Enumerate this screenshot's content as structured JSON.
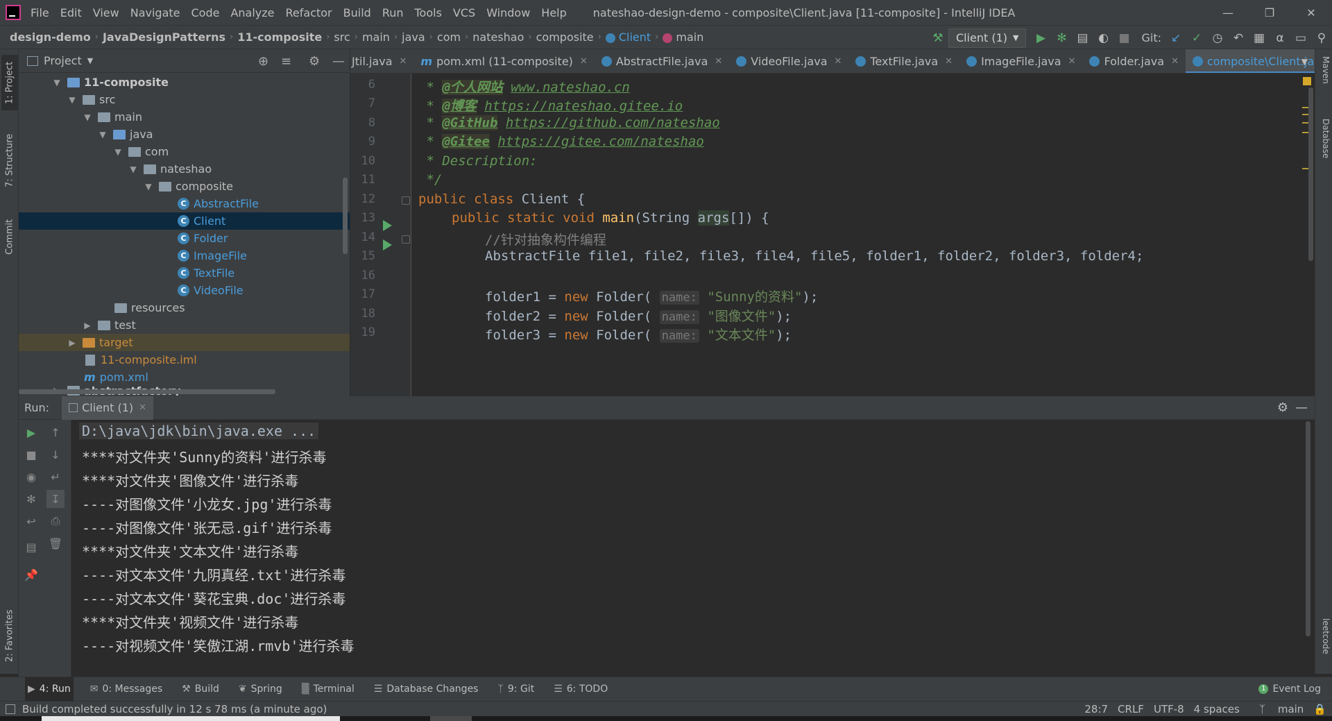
{
  "menubar": {
    "items": [
      "File",
      "Edit",
      "View",
      "Navigate",
      "Code",
      "Analyze",
      "Refactor",
      "Build",
      "Run",
      "Tools",
      "VCS",
      "Window",
      "Help"
    ],
    "window_title": "nateshao-design-demo - composite\\Client.java [11-composite] - IntelliJ IDEA"
  },
  "navbar": {
    "crumbs": [
      "design-demo",
      "JavaDesignPatterns",
      "11-composite",
      "src",
      "main",
      "java",
      "com",
      "nateshao",
      "composite"
    ],
    "class_name": "Client",
    "method_name": "main",
    "run_config": "Client (1)",
    "git_label": "Git:"
  },
  "project": {
    "title": "Project",
    "tree": [
      {
        "label": "11-composite",
        "kind": "module"
      },
      {
        "label": "src",
        "kind": "folder"
      },
      {
        "label": "main",
        "kind": "folder"
      },
      {
        "label": "java",
        "kind": "folder"
      },
      {
        "label": "com",
        "kind": "folder"
      },
      {
        "label": "nateshao",
        "kind": "folder"
      },
      {
        "label": "composite",
        "kind": "folder"
      },
      {
        "label": "AbstractFile",
        "kind": "class"
      },
      {
        "label": "Client",
        "kind": "class"
      },
      {
        "label": "Folder",
        "kind": "class"
      },
      {
        "label": "ImageFile",
        "kind": "class"
      },
      {
        "label": "TextFile",
        "kind": "class"
      },
      {
        "label": "VideoFile",
        "kind": "class"
      },
      {
        "label": "resources",
        "kind": "folder"
      },
      {
        "label": "test",
        "kind": "folder"
      },
      {
        "label": "target",
        "kind": "folder"
      },
      {
        "label": "11-composite.iml",
        "kind": "file"
      },
      {
        "label": "pom.xml",
        "kind": "file"
      },
      {
        "label": "abstractfactory",
        "kind": "module"
      }
    ]
  },
  "tabs": [
    {
      "label": "Jtil.java"
    },
    {
      "label": "pom.xml (11-composite)"
    },
    {
      "label": "AbstractFile.java"
    },
    {
      "label": "VideoFile.java"
    },
    {
      "label": "TextFile.java"
    },
    {
      "label": "ImageFile.java"
    },
    {
      "label": "Folder.java"
    },
    {
      "label": "composite\\Client.java"
    }
  ],
  "editor": {
    "line_numbers": [
      "6",
      "7",
      "8",
      "9",
      "10",
      "11",
      "12",
      "13",
      "14",
      "15",
      "16",
      "17",
      "18",
      "19"
    ],
    "line6": {
      "star": " * ",
      "tag": "@个人网站",
      "url": "www.nateshao.cn"
    },
    "line7": {
      "star": " * ",
      "tag": "@博客",
      "url": "https://nateshao.gitee.io"
    },
    "line8": {
      "star": " * ",
      "tag": "@GitHub",
      "url": "https://github.com/nateshao"
    },
    "line9": {
      "star": " * ",
      "tag": "@Gitee",
      "url": "https://gitee.com/nateshao"
    },
    "line10": " * Description:",
    "line11": " */",
    "line12": {
      "kw": "public class ",
      "name": "Client {"
    },
    "line13": {
      "kw": "public static void ",
      "fn": "main",
      "pre": "(String ",
      "param": "args",
      "post": "[]) {"
    },
    "line14": "//针对抽象构件编程",
    "line15": "AbstractFile file1, file2, file3, file4, file5, folder1, folder2, folder3, folder4;",
    "line17": {
      "pre": "folder1 = ",
      "kw": "new ",
      "cls": "Folder(",
      "hint": "name:",
      "str": "\"Sunny的资料\"",
      "post": ");"
    },
    "line18": {
      "pre": "folder2 = ",
      "kw": "new ",
      "cls": "Folder(",
      "hint": "name:",
      "str": "\"图像文件\"",
      "post": ");"
    },
    "line19": {
      "pre": "folder3 = ",
      "kw": "new ",
      "cls": "Folder(",
      "hint": "name:",
      "str": "\"文本文件\"",
      "post": ");"
    }
  },
  "run": {
    "label": "Run:",
    "tab": "Client (1)",
    "console": [
      "D:\\java\\jdk\\bin\\java.exe ...",
      "****对文件夹'Sunny的资料'进行杀毒",
      "****对文件夹'图像文件'进行杀毒",
      "----对图像文件'小龙女.jpg'进行杀毒",
      "----对图像文件'张无忌.gif'进行杀毒",
      "****对文件夹'文本文件'进行杀毒",
      "----对文本文件'九阴真经.txt'进行杀毒",
      "----对文本文件'葵花宝典.doc'进行杀毒",
      "****对文件夹'视频文件'进行杀毒",
      "----对视频文件'笑傲江湖.rmvb'进行杀毒"
    ]
  },
  "side_tabs": {
    "left": [
      "1: Project",
      "7: Structure",
      "Commit",
      "2: Favorites"
    ],
    "right": [
      "Maven",
      "Database",
      "leetcode"
    ]
  },
  "bottom_tabs": [
    "4: Run",
    "0: Messages",
    "Build",
    "Spring",
    "Terminal",
    "Database Changes",
    "9: Git",
    "6: TODO"
  ],
  "event_log": "Event Log",
  "status": {
    "message": "Build completed successfully in 12 s 78 ms (a minute ago)",
    "position": "28:7",
    "line_sep": "CRLF",
    "encoding": "UTF-8",
    "indent": "4 spaces",
    "branch": "main"
  }
}
